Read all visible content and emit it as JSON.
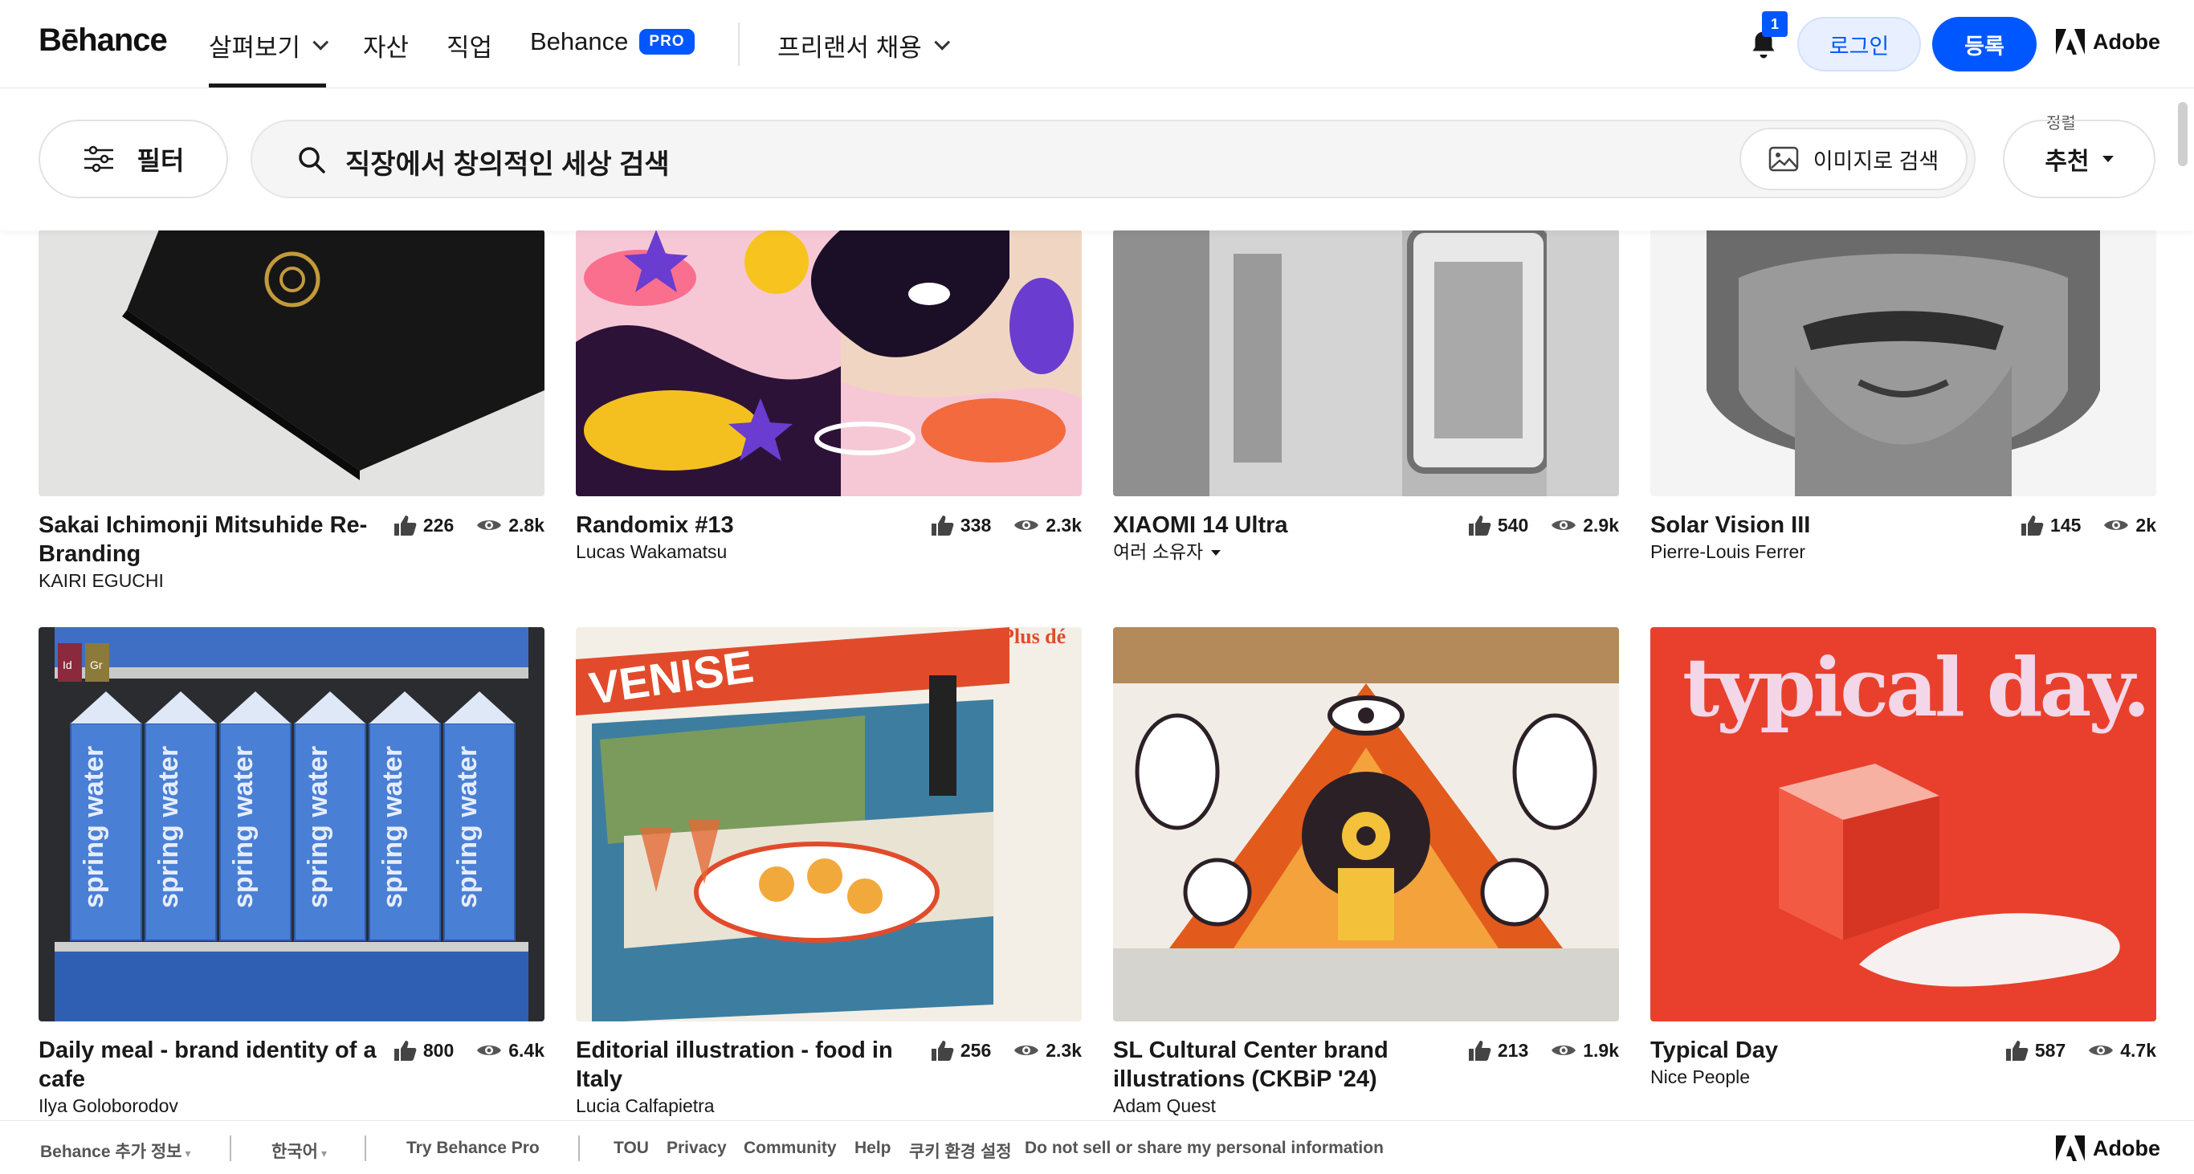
{
  "nav": {
    "logo": "Bēhance",
    "items": [
      {
        "label": "살펴보기"
      },
      {
        "label": "자산"
      },
      {
        "label": "직업"
      },
      {
        "label": "Behance"
      },
      {
        "label": "프리랜서 채용"
      }
    ],
    "pro_badge": "PRO",
    "notification_count": "1",
    "login": "로그인",
    "signup": "등록",
    "adobe": "Adobe"
  },
  "search": {
    "filter_label": "필터",
    "query": "직장에서 창의적인 세상 검색",
    "image_search_label": "이미지로 검색",
    "sort_caption": "정렬",
    "sort_value": "추천"
  },
  "projects": [
    {
      "title": "Sakai Ichimonji Mitsuhide Re-Branding",
      "owner": "KAIRI EGUCHI",
      "likes": "226",
      "views": "2.8k"
    },
    {
      "title": "Randomix #13",
      "owner": "Lucas Wakamatsu",
      "likes": "338",
      "views": "2.3k"
    },
    {
      "title": "XIAOMI 14 Ultra",
      "owner": "여러 소유자",
      "likes": "540",
      "views": "2.9k"
    },
    {
      "title": "Solar Vision III",
      "owner": "Pierre-Louis Ferrer",
      "likes": "145",
      "views": "2k"
    },
    {
      "title": "Daily meal - brand identity of a cafe",
      "owner": "Ilya Goloborodov",
      "likes": "800",
      "views": "6.4k"
    },
    {
      "title": "Editorial illustration - food in Italy",
      "owner": "Lucia Calfapietra",
      "likes": "256",
      "views": "2.3k"
    },
    {
      "title": "SL Cultural Center brand illustrations (CKBiP '24)",
      "owner": "Adam Quest",
      "likes": "213",
      "views": "1.9k"
    },
    {
      "title": "Typical Day",
      "owner": "Nice People",
      "likes": "587",
      "views": "4.7k"
    }
  ],
  "artwork_text": {
    "typical": "typical day.",
    "venise": "VENISE",
    "plus": "Plus dé",
    "carton": "spring water",
    "tag_id": "Id",
    "tag_gr": "Gr"
  },
  "footer": {
    "more_info": "Behance 추가 정보",
    "language": "한국어",
    "try_pro": "Try Behance Pro",
    "links": [
      "TOU",
      "Privacy",
      "Community",
      "Help",
      "쿠키 환경 설정",
      "Do not sell or share my personal information"
    ],
    "adobe": "Adobe"
  },
  "colors": {
    "accent": "#0057ff"
  }
}
